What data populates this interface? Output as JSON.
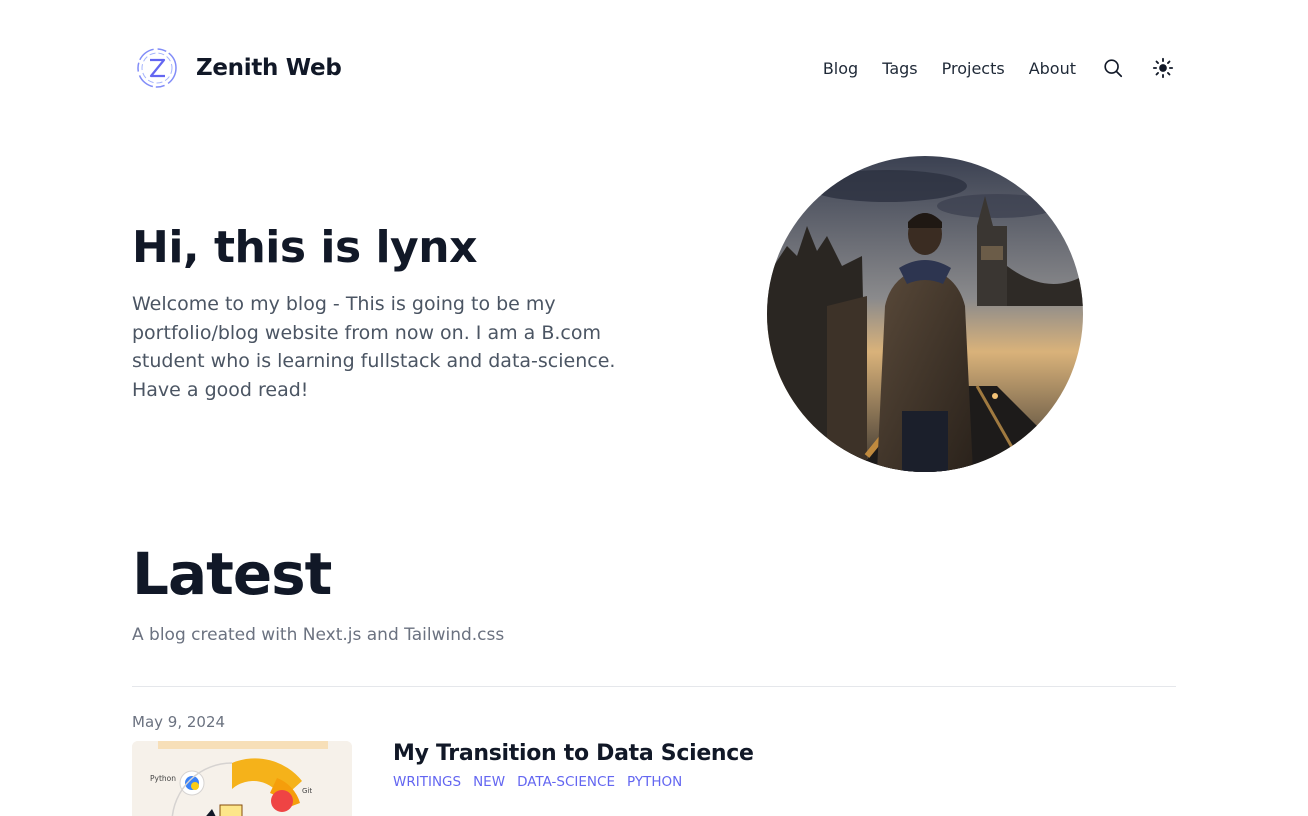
{
  "header": {
    "brand_name": "Zenith Web",
    "nav": [
      {
        "label": "Blog"
      },
      {
        "label": "Tags"
      },
      {
        "label": "Projects"
      },
      {
        "label": "About"
      }
    ]
  },
  "hero": {
    "title": "Hi, this is lynx",
    "description": "Welcome to my blog - This is going to be my portfolio/blog website from now on. I am a B.com student who is learning fullstack and data-science. Have a good read!"
  },
  "latest": {
    "title": "Latest",
    "subtitle": "A blog created with Next.js and Tailwind.css",
    "posts": [
      {
        "date": "May 9, 2024",
        "title": "My Transition to Data Science",
        "tags": [
          "WRITINGS",
          "NEW",
          "DATA-SCIENCE",
          "PYTHON"
        ],
        "thumb_labels": {
          "python": "Python",
          "git": "Git"
        }
      }
    ]
  },
  "colors": {
    "accent": "#6366f1",
    "text": "#111827",
    "muted": "#6b7280"
  },
  "icons": [
    "zenith-logo-icon",
    "search-icon",
    "sun-icon"
  ]
}
